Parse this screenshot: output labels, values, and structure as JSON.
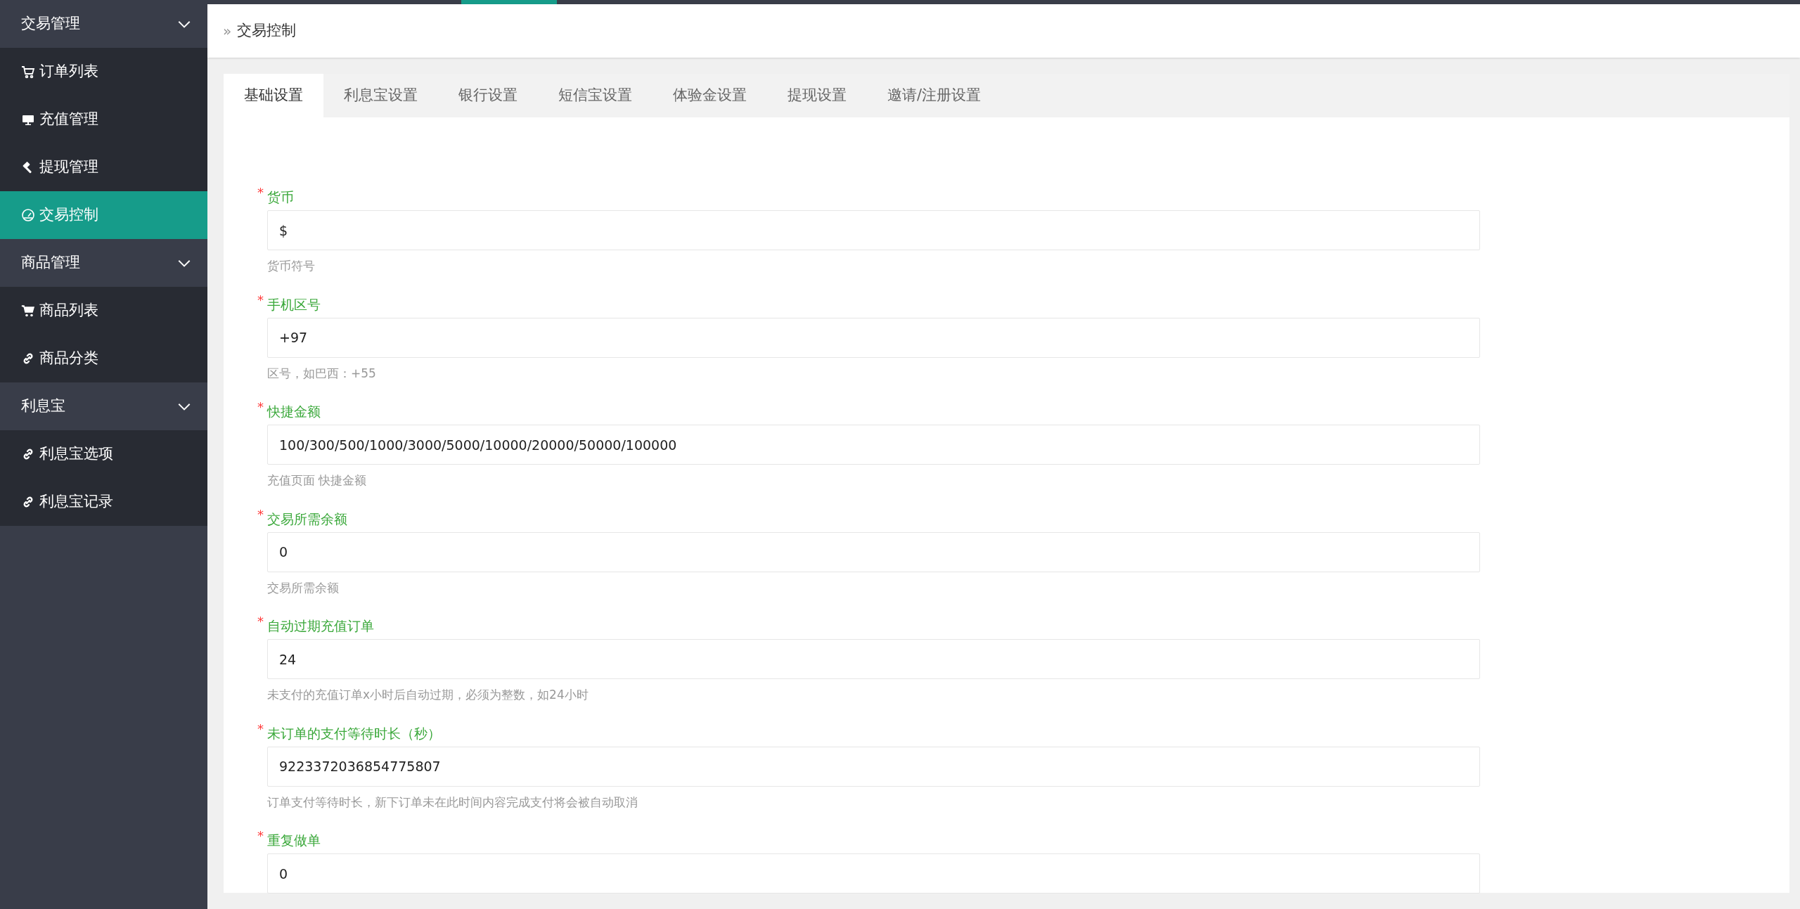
{
  "sidebar": {
    "groups": [
      {
        "label": "交易管理",
        "expanded": true,
        "items": [
          {
            "label": "订单列表",
            "kind": "cart",
            "selected": false
          },
          {
            "label": "充值管理",
            "kind": "monitor",
            "selected": false
          },
          {
            "label": "提现管理",
            "kind": "gavel",
            "selected": false
          },
          {
            "label": "交易控制",
            "kind": "gauge",
            "selected": true
          }
        ]
      },
      {
        "label": "商品管理",
        "expanded": true,
        "items": [
          {
            "label": "商品列表",
            "kind": "cartfilled",
            "selected": false
          },
          {
            "label": "商品分类",
            "kind": "link",
            "selected": false
          }
        ]
      },
      {
        "label": "利息宝",
        "expanded": true,
        "items": [
          {
            "label": "利息宝选项",
            "kind": "link",
            "selected": false
          },
          {
            "label": "利息宝记录",
            "kind": "link",
            "selected": false
          }
        ]
      }
    ]
  },
  "breadcrumb": {
    "separator": "»",
    "current": "交易控制"
  },
  "tabs": [
    {
      "label": "基础设置",
      "selected": true
    },
    {
      "label": "利息宝设置",
      "selected": false
    },
    {
      "label": "银行设置",
      "selected": false
    },
    {
      "label": "短信宝设置",
      "selected": false
    },
    {
      "label": "体验金设置",
      "selected": false
    },
    {
      "label": "提现设置",
      "selected": false
    },
    {
      "label": "邀请/注册设置",
      "selected": false
    }
  ],
  "form": [
    {
      "label": "货币",
      "required_mark": "*",
      "value": "$",
      "hint": "货币符号"
    },
    {
      "label": "手机区号",
      "required_mark": "*",
      "value": "+97",
      "hint": "区号，如巴西：+55"
    },
    {
      "label": "快捷金额",
      "required_mark": "*",
      "value": "100/300/500/1000/3000/5000/10000/20000/50000/100000",
      "hint": "充值页面 快捷金额"
    },
    {
      "label": "交易所需余额",
      "required_mark": "*",
      "value": "0",
      "hint": "交易所需余额"
    },
    {
      "label": "自动过期充值订单",
      "required_mark": "*",
      "value": "24",
      "hint": "未支付的充值订单x小时后自动过期，必须为整数，如24小时"
    },
    {
      "label": "未订单的支付等待时长（秒）",
      "required_mark": "*",
      "value": "9223372036854775807",
      "hint": "订单支付等待时长，新下订单未在此时间内容完成支付将会被自动取消"
    },
    {
      "label": "重复做单",
      "required_mark": "*",
      "value": "0"
    }
  ]
}
